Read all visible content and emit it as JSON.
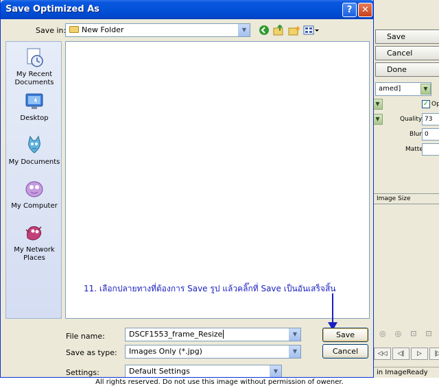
{
  "dialog": {
    "title": "Save Optimized As",
    "save_in_label": "Save in:",
    "save_in_value": "New Folder",
    "places": [
      {
        "label": "My Recent Documents",
        "icon": "recent-documents-icon"
      },
      {
        "label": "Desktop",
        "icon": "desktop-icon"
      },
      {
        "label": "My Documents",
        "icon": "my-documents-icon"
      },
      {
        "label": "My Computer",
        "icon": "my-computer-icon"
      },
      {
        "label": "My Network Places",
        "icon": "network-places-icon"
      }
    ],
    "annotation": "11. เลือกปลายทางที่ต้องการ Save รูป แล้วคลิ๊กที่ Save เป็นอันเสร็จสิ้น",
    "file_name_label": "File name:",
    "file_name_value": "DSCF1553_frame_Resize",
    "save_as_type_label": "Save as type:",
    "save_as_type_value": "Images Only (*.jpg)",
    "settings_label": "Settings:",
    "settings_value": "Default Settings",
    "save_button": "Save",
    "cancel_button": "Cancel"
  },
  "background_window": {
    "save_button": "Save",
    "cancel_button": "Cancel",
    "done_button": "Done",
    "select_value": "amed]",
    "optimized_label": "Op",
    "quality_label": "Quality:",
    "quality_value": "73",
    "blur_label": "Blur:",
    "blur_value": "0",
    "matte_label": "Matte:",
    "tab_label": "Image Size",
    "status_text": "in ImageReady"
  },
  "footer_text": "All rights reserved. Do not use this image without permission of owener.",
  "colors": {
    "titlebar": "#0252d8",
    "annotation": "#1a1fbe",
    "dialog_bg": "#ece9d8"
  }
}
